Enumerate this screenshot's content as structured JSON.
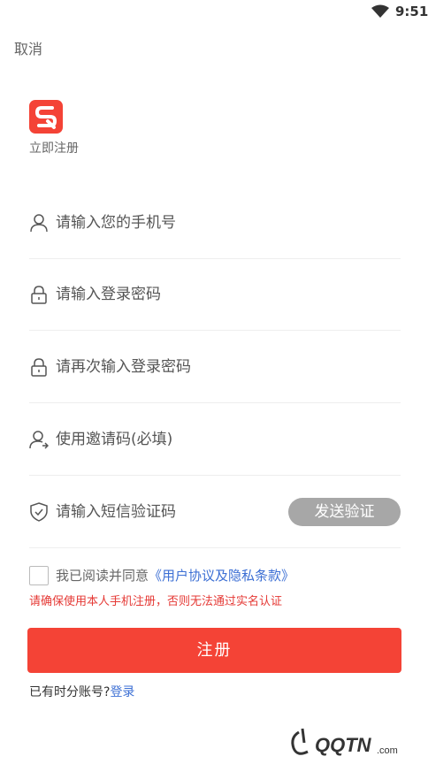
{
  "status_bar": {
    "time": "9:51",
    "wifi_icon": "wifi-icon"
  },
  "header": {
    "cancel_label": "取消"
  },
  "brand": {
    "logo_icon": "app-logo",
    "logo_color": "#f44336",
    "subtitle": "立即注册"
  },
  "form": {
    "phone": {
      "placeholder": "请输入您的手机号",
      "icon": "user-icon"
    },
    "password": {
      "placeholder": "请输入登录密码",
      "icon": "lock-icon"
    },
    "password_confirm": {
      "placeholder": "请再次输入登录密码",
      "icon": "lock-icon"
    },
    "invite_code": {
      "placeholder": "使用邀请码(必填)",
      "icon": "add-user-icon"
    },
    "sms_code": {
      "placeholder": "请输入短信验证码",
      "icon": "shield-check-icon"
    },
    "send_code_label": "发送验证"
  },
  "agreement": {
    "prefix": "我已阅读并同意",
    "link": "《用户协议及隐私条款》",
    "checked": false
  },
  "warning": "请确保使用本人手机注册，否则无法通过实名认证",
  "register_label": "注册",
  "login_prompt": {
    "text": "已有时分账号?",
    "link": "登录"
  },
  "colors": {
    "accent": "#f44336",
    "link": "#3c6fd4",
    "warning": "#e53935",
    "button_disabled": "#a7a7a7"
  }
}
